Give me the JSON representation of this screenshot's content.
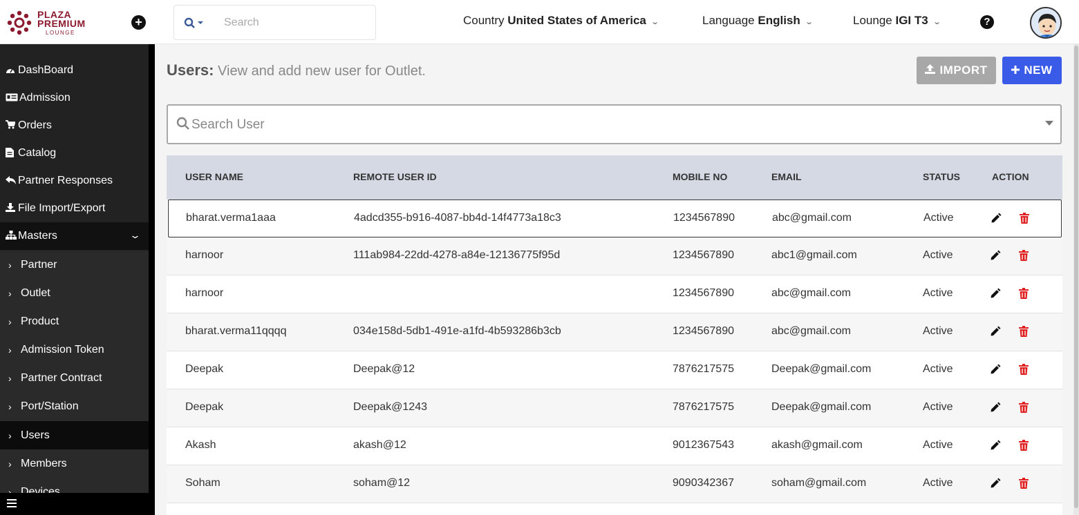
{
  "brand": {
    "line1": "PLAZA",
    "line2": "PREMIUM",
    "line3": "LOUNGE",
    "color": "#8b1a2f"
  },
  "topbar": {
    "search_placeholder": "Search",
    "country_label": "Country",
    "country_value": "United States of America",
    "language_label": "Language",
    "language_value": "English",
    "lounge_label": "Lounge",
    "lounge_value": "IGI T3",
    "help_glyph": "?"
  },
  "sidebar": {
    "items": [
      {
        "label": "DashBoard",
        "icon": "dashboard-icon"
      },
      {
        "label": "Admission",
        "icon": "id-card-icon"
      },
      {
        "label": "Orders",
        "icon": "cart-icon"
      },
      {
        "label": "Catalog",
        "icon": "file-icon"
      },
      {
        "label": "Partner Responses",
        "icon": "reply-icon"
      },
      {
        "label": "File Import/Export",
        "icon": "download-icon"
      },
      {
        "label": "Masters",
        "icon": "sitemap-icon"
      }
    ],
    "sub_items": [
      {
        "label": "Partner"
      },
      {
        "label": "Outlet"
      },
      {
        "label": "Product"
      },
      {
        "label": "Admission Token"
      },
      {
        "label": "Partner Contract"
      },
      {
        "label": "Port/Station"
      },
      {
        "label": "Users"
      },
      {
        "label": "Members"
      },
      {
        "label": "Devices"
      }
    ],
    "active": "Users"
  },
  "page": {
    "title": "Users:",
    "subtitle": "View and add new user for Outlet.",
    "import_label": "IMPORT",
    "new_label": "NEW",
    "user_search_placeholder": "Search User"
  },
  "table": {
    "headers": [
      "USER NAME",
      "REMOTE USER ID",
      "MOBILE NO",
      "EMAIL",
      "STATUS",
      "ACTION"
    ],
    "rows": [
      {
        "name": "bharat.verma1aaa",
        "remote_id": "4adcd355-b916-4087-bb4d-14f4773a18c3",
        "mobile": "1234567890",
        "email": "abc@gmail.com",
        "status": "Active"
      },
      {
        "name": "harnoor",
        "remote_id": "111ab984-22dd-4278-a84e-12136775f95d",
        "mobile": "1234567890",
        "email": "abc1@gmail.com",
        "status": "Active"
      },
      {
        "name": "harnoor",
        "remote_id": "",
        "mobile": "1234567890",
        "email": "abc@gmail.com",
        "status": "Active"
      },
      {
        "name": "bharat.verma11qqqq",
        "remote_id": "034e158d-5db1-491e-a1fd-4b593286b3cb",
        "mobile": "1234567890",
        "email": "abc@gmail.com",
        "status": "Active"
      },
      {
        "name": "Deepak",
        "remote_id": "Deepak@12",
        "mobile": "7876217575",
        "email": "Deepak@gmail.com",
        "status": "Active"
      },
      {
        "name": "Deepak",
        "remote_id": "Deepak@1243",
        "mobile": "7876217575",
        "email": "Deepak@gmail.com",
        "status": "Active"
      },
      {
        "name": "Akash",
        "remote_id": "akash@12",
        "mobile": "9012367543",
        "email": "akash@gmail.com",
        "status": "Active"
      },
      {
        "name": "Soham",
        "remote_id": "soham@12",
        "mobile": "9090342367",
        "email": "soham@gmail.com",
        "status": "Active"
      }
    ]
  },
  "colors": {
    "primary": "#3a5ae8",
    "import_btn": "#a8a8a8",
    "delete": "#e02020",
    "sidebar": "#222222",
    "table_header": "#d4d9e4"
  }
}
